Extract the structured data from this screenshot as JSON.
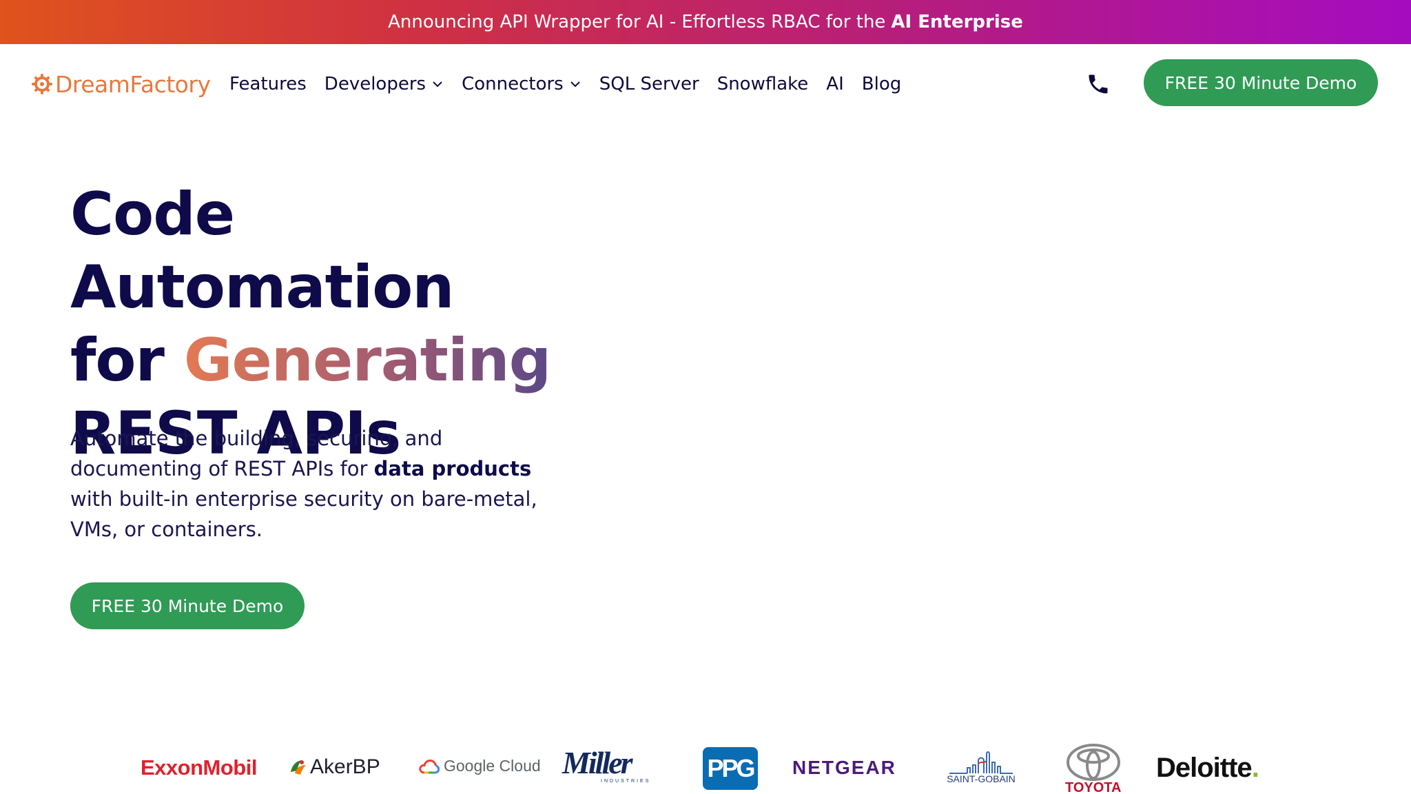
{
  "announcement": {
    "text": "Announcing API Wrapper for AI - Effortless RBAC for the",
    "bold": "AI Enterprise"
  },
  "nav": {
    "logo_text": "DreamFactory",
    "items": [
      {
        "label": "Features",
        "has_dropdown": false
      },
      {
        "label": "Developers",
        "has_dropdown": true
      },
      {
        "label": "Connectors",
        "has_dropdown": true
      },
      {
        "label": "SQL Server",
        "has_dropdown": false
      },
      {
        "label": "Snowflake",
        "has_dropdown": false
      },
      {
        "label": "AI",
        "has_dropdown": false
      },
      {
        "label": "Blog",
        "has_dropdown": false
      }
    ],
    "phone_icon": "phone-icon",
    "cta_label": "FREE 30 Minute Demo"
  },
  "hero": {
    "title_line1": "Code Automation",
    "title_line2_plain": "for",
    "title_line2_gradient": "Generating",
    "title_line3": "REST APIs",
    "subtitle_part1": "Automate the building, securing, and documenting of REST APIs for",
    "subtitle_bold": "data products",
    "subtitle_part2": "with built-in enterprise security on bare-metal, VMs, or containers.",
    "cta_label": "FREE 30 Minute Demo"
  },
  "customer_logos": {
    "exxon": "ExxonMobil",
    "akerbp": "AkerBP",
    "gcloud": "Google Cloud",
    "miller": "Miller",
    "miller_sub": "INDUSTRIES",
    "ppg": "PPG",
    "netgear": "NETGEAR",
    "saint_gobain": "SAINT-GOBAIN",
    "toyota": "TOYOTA",
    "deloitte": "Deloitte",
    "deloitte_dot": "."
  },
  "colors": {
    "brand_orange": "#e7793c",
    "navy": "#0f0a4a",
    "cta_green": "#2f9b55"
  }
}
